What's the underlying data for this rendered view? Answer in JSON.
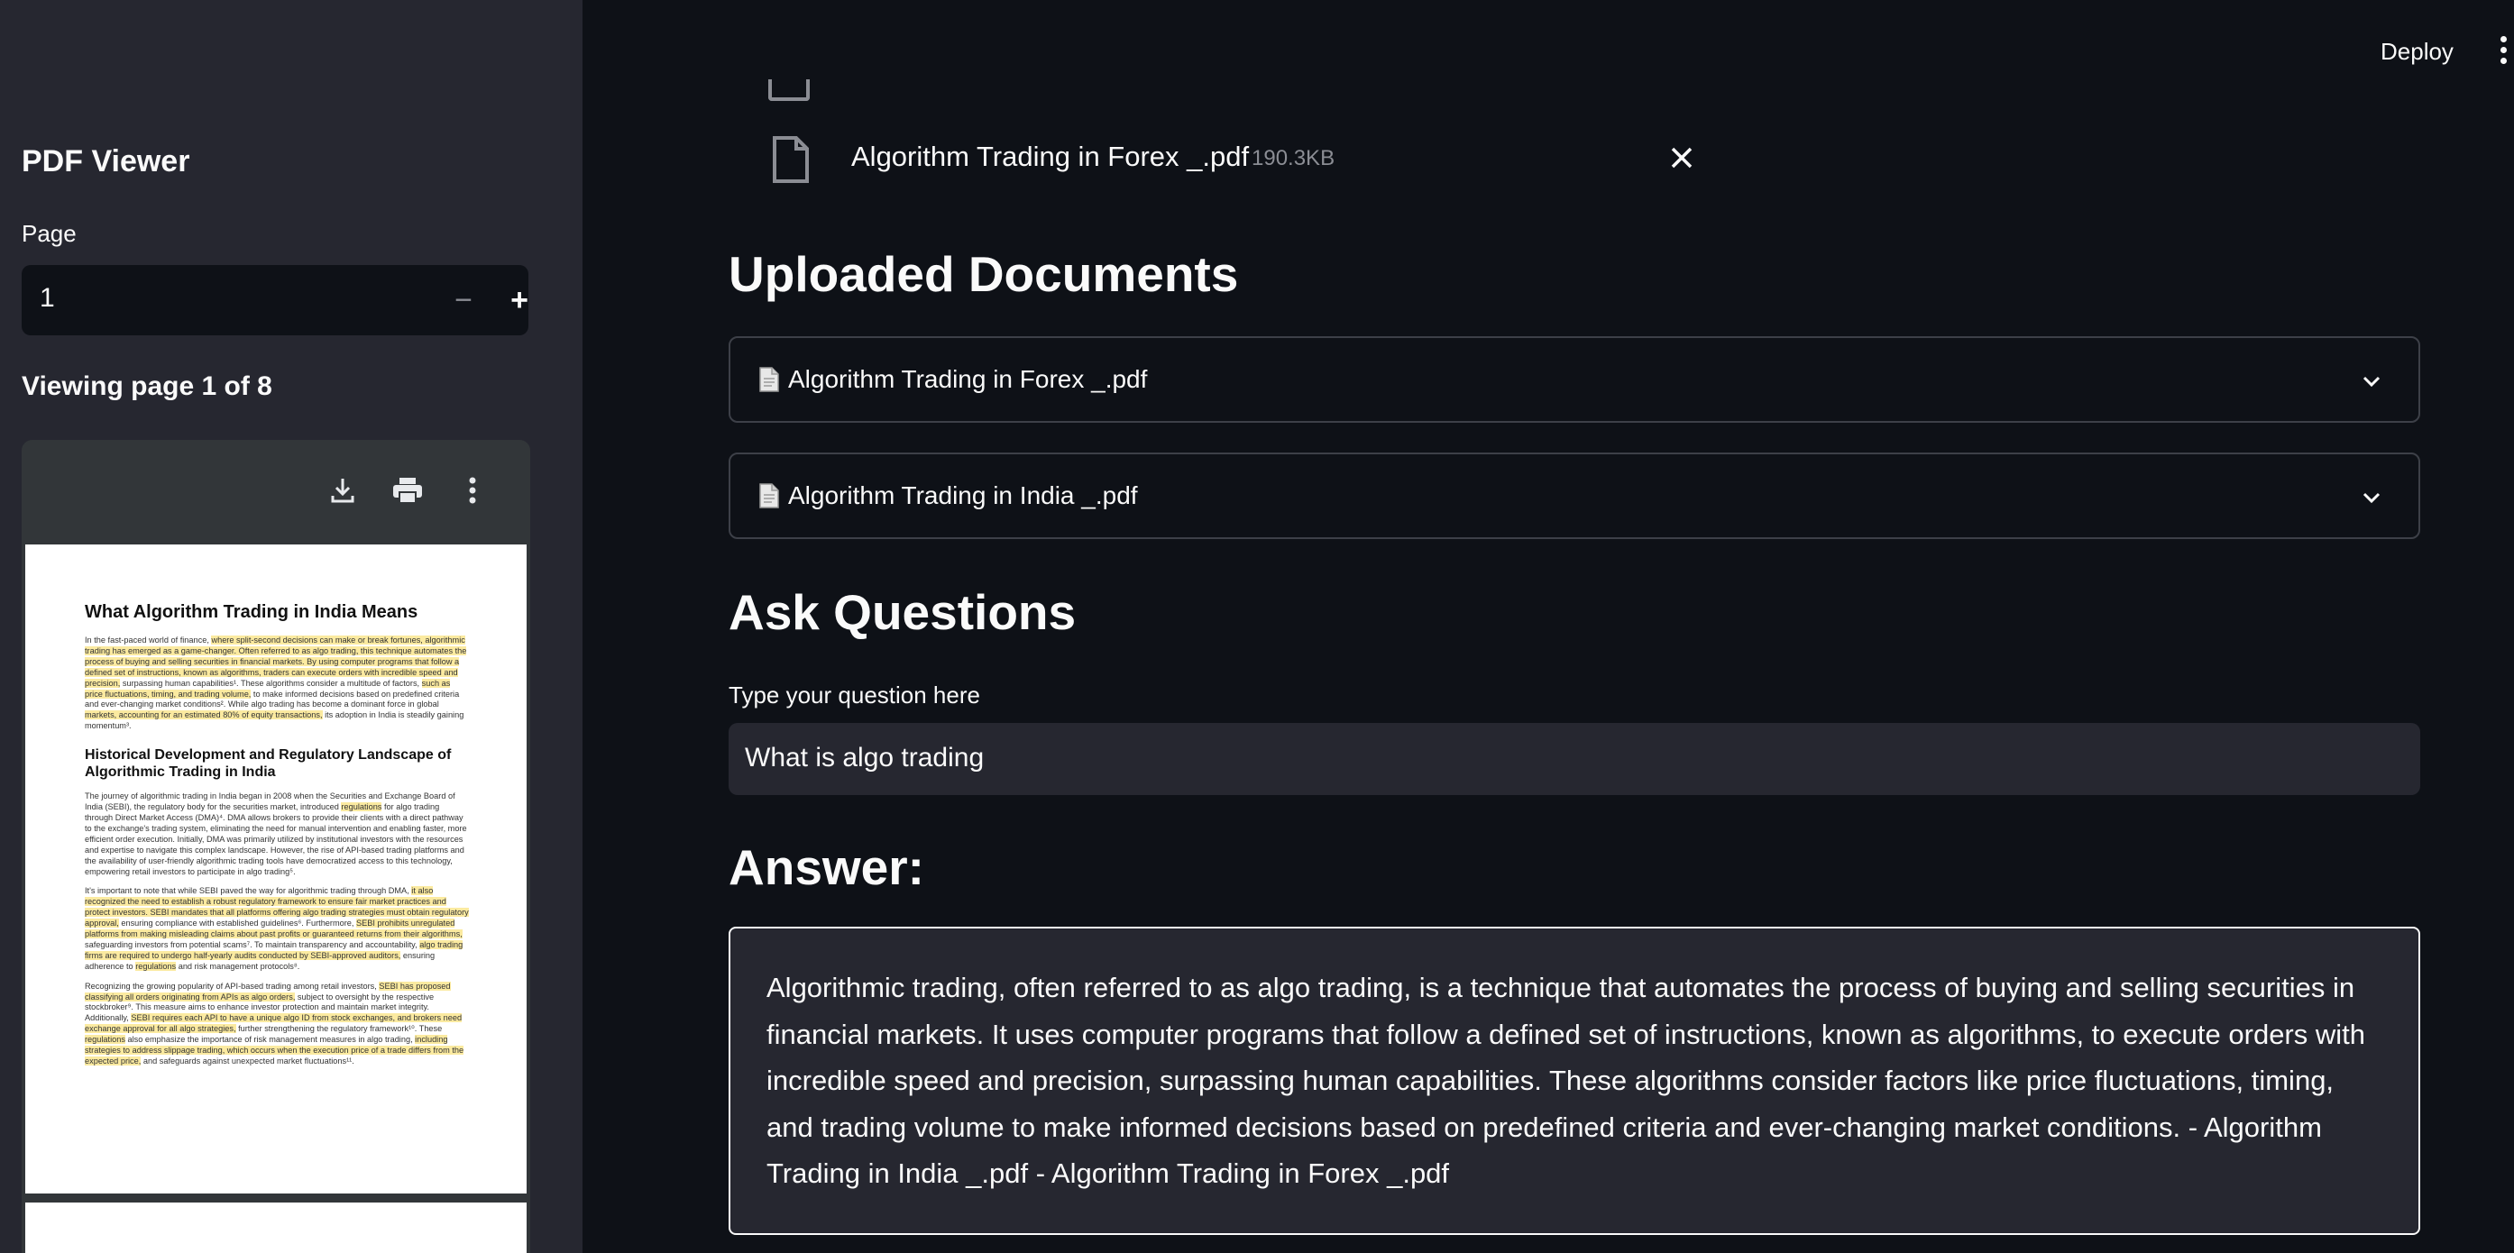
{
  "sidebar": {
    "title": "PDF Viewer",
    "page_label": "Page",
    "page_value": "1",
    "minus_symbol": "−",
    "plus_symbol": "+",
    "viewing_text": "Viewing page 1 of 8"
  },
  "pdf": {
    "heading": "What Algorithm Trading in India Means",
    "subheading": "Historical Development and Regulatory Landscape of Algorithmic Trading in India"
  },
  "header": {
    "deploy_label": "Deploy"
  },
  "uploader": {
    "file_name": "Algorithm Trading in Forex _.pdf",
    "file_size": "190.3KB"
  },
  "uploaded": {
    "heading": "Uploaded Documents",
    "documents": [
      {
        "label": "Algorithm Trading in Forex _.pdf"
      },
      {
        "label": "Algorithm Trading in India _.pdf"
      }
    ]
  },
  "ask": {
    "heading": "Ask Questions",
    "input_label": "Type your question here",
    "input_value": "What is algo trading"
  },
  "answer": {
    "heading": "Answer:",
    "text": "Algorithmic trading, often referred to as algo trading, is a technique that automates the process of buying and selling securities in financial markets. It uses computer programs that follow a defined set of instructions, known as algorithms, to execute orders with incredible speed and precision, surpassing human capabilities. These algorithms consider factors like price fluctuations, timing, and trading volume to make informed decisions based on predefined criteria and ever-changing market conditions. - Algorithm Trading in India _.pdf - Algorithm Trading in Forex _.pdf"
  },
  "colors": {
    "background": "#0e1117",
    "sidebar": "#262730",
    "highlight": "#fbeaa0"
  }
}
